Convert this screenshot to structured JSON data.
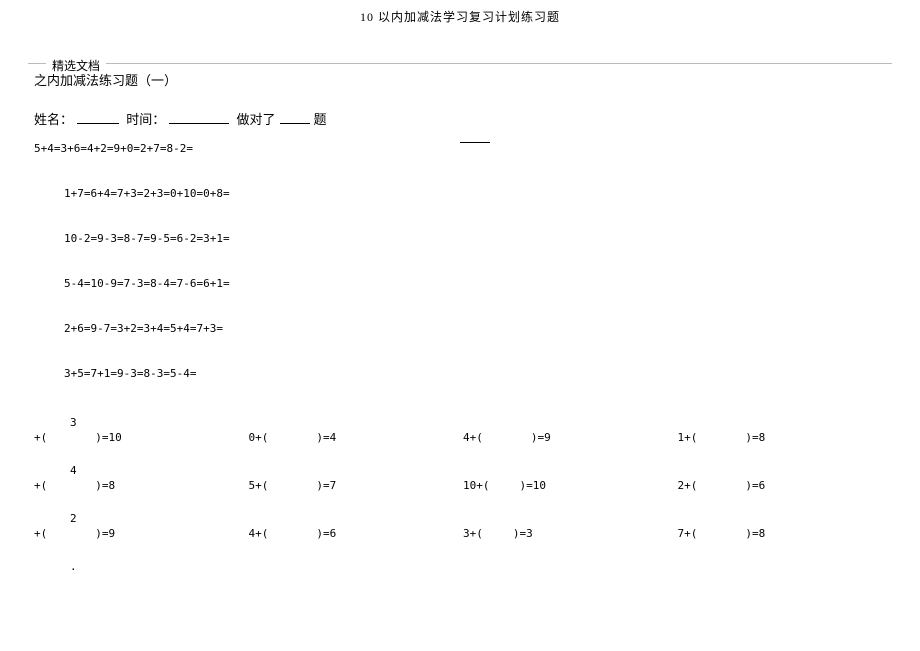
{
  "doc": {
    "title": "10 以内加减法学习复习计划练习题",
    "header_label": "精选文档",
    "subtitle": "之内加减法练习题（一）",
    "name_label": "姓名：",
    "time_label": "时间：",
    "correct_prefix": "做对了",
    "correct_suffix": "题"
  },
  "equations": {
    "line1": "5+4=3+6=4+2=9+0=2+7=8-2=",
    "line2": "1+7=6+4=7+3=2+3=0+10=0+8=",
    "line3": "10-2=9-3=8-7=9-5=6-2=3+1=",
    "line4": "5-4=10-9=7-3=8-4=7-6=6+1=",
    "line5": "2+6=9-7=3+2=3+4=5+4=7+3=",
    "line6": "3+5=7+1=9-3=8-3=5-4="
  },
  "paren_rows": [
    {
      "above": "3",
      "cells": [
        {
          "lead": "+(",
          "eq": ")=10"
        },
        {
          "lead": "0+(",
          "eq": ")=4"
        },
        {
          "lead": "4+(",
          "eq": ")=9"
        },
        {
          "lead": "1+(",
          "eq": ")=8"
        }
      ]
    },
    {
      "above": "4",
      "cells": [
        {
          "lead": "+(",
          "eq": ")=8"
        },
        {
          "lead": "5+(",
          "eq": ")=7"
        },
        {
          "lead": "10+(",
          "eq": ")=10",
          "small": true
        },
        {
          "lead": "2+(",
          "eq": ")=6"
        }
      ]
    },
    {
      "above": "2",
      "cells": [
        {
          "lead": "+(",
          "eq": ")=9"
        },
        {
          "lead": "4+(",
          "eq": ")=6"
        },
        {
          "lead": "3+(",
          "eq": ")=3",
          "small": true
        },
        {
          "lead": "7+(",
          "eq": ")=8"
        }
      ]
    }
  ],
  "final_dot": "."
}
